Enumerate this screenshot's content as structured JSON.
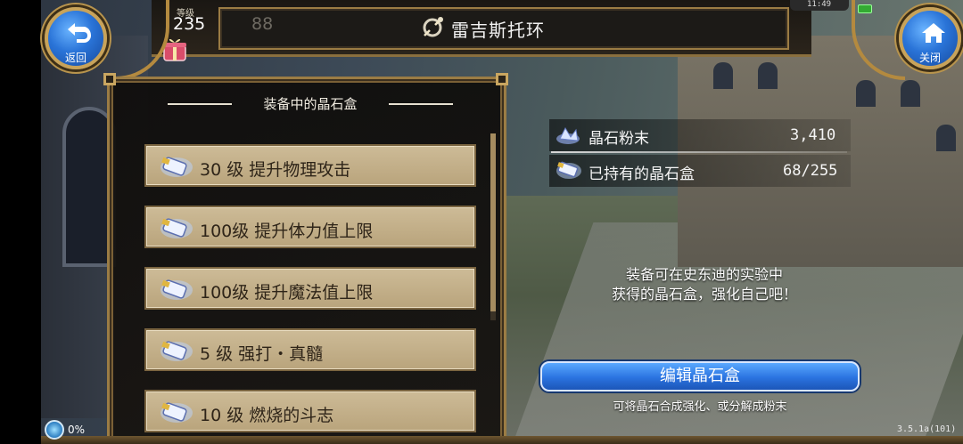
{
  "header": {
    "title": "雷吉斯托环",
    "level_label": "等级",
    "level_value": "235",
    "ghost_number": "88"
  },
  "status": {
    "time": "11:49"
  },
  "nav": {
    "back_label": "返回",
    "close_label": "关闭"
  },
  "panel": {
    "header": "装备中的晶石盒",
    "items": [
      {
        "label": "30 级 提升物理攻击"
      },
      {
        "label": "100级 提升体力值上限"
      },
      {
        "label": "100级 提升魔法值上限"
      },
      {
        "label": "5 级 强打・真髓"
      },
      {
        "label": "10 级 燃烧的斗志"
      }
    ]
  },
  "info": {
    "powder_label": "晶石粉末",
    "powder_value": "3,410",
    "owned_label": "已持有的晶石盒",
    "owned_value": "68/255",
    "hint_line1": "装备可在史东迪的实验中",
    "hint_line2": "获得的晶石盒，强化自己吧！",
    "edit_button": "编辑晶石盒",
    "edit_sub": "可将晶石合成强化、或分解成粉末"
  },
  "footer": {
    "progress": "0%",
    "version": "3.5.1a(101)"
  },
  "colors": {
    "accent_blue": "#2a73e0",
    "gold_frame": "#9b7c44",
    "item_bg": "#c6b28b"
  }
}
